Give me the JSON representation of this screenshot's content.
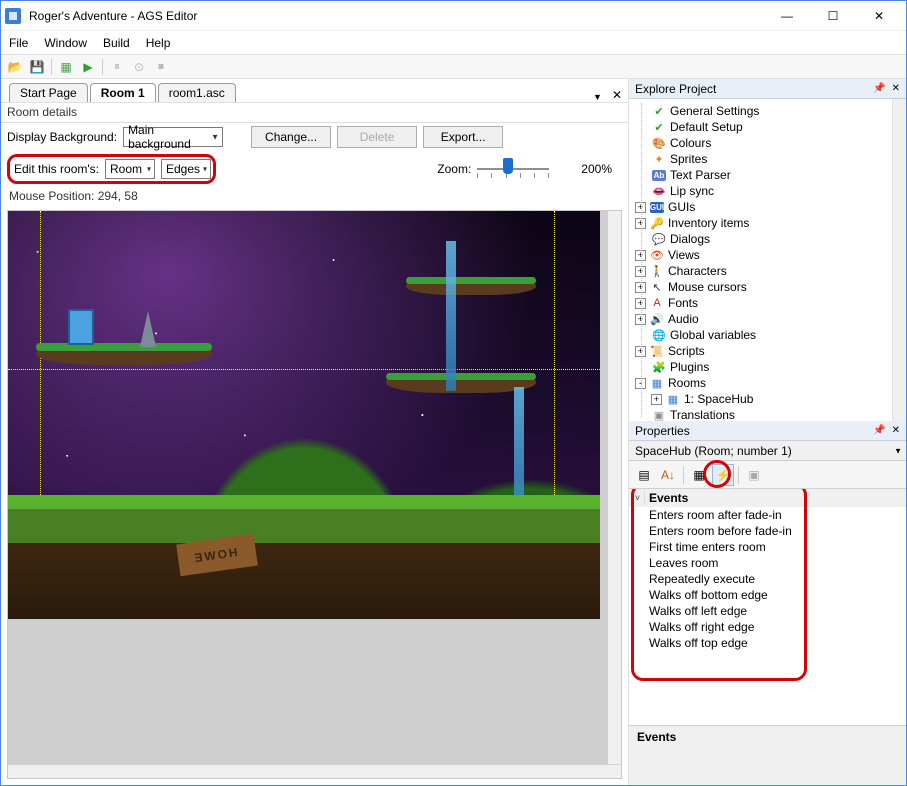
{
  "window": {
    "title": "Roger's Adventure - AGS Editor"
  },
  "menu": {
    "file": "File",
    "window": "Window",
    "build": "Build",
    "help": "Help"
  },
  "tabs": {
    "start": "Start Page",
    "room": "Room 1",
    "script": "room1.asc"
  },
  "roomEditor": {
    "detailsLabel": "Room details",
    "displayBgLabel": "Display Background:",
    "displayBgValue": "Main background",
    "changeBtn": "Change...",
    "deleteBtn": "Delete",
    "exportBtn": "Export...",
    "editLabel": "Edit this room's:",
    "roomCombo": "Room",
    "edgesCombo": "Edges",
    "zoomLabel": "Zoom:",
    "zoomValue": "200%",
    "mousePosLabel": "Mouse Position: 294, 58"
  },
  "explore": {
    "title": "Explore Project",
    "items": [
      {
        "icon": "✔",
        "color": "#2e9f2e",
        "label": "General Settings",
        "exp": ""
      },
      {
        "icon": "✔",
        "color": "#2e9f2e",
        "label": "Default Setup",
        "exp": ""
      },
      {
        "icon": "🎨",
        "color": "#d28c2c",
        "label": "Colours",
        "exp": ""
      },
      {
        "icon": "✦",
        "color": "#d28c2c",
        "label": "Sprites",
        "exp": ""
      },
      {
        "icon": "Ab",
        "color": "#5a7bd8",
        "label": "Text Parser",
        "exp": ""
      },
      {
        "icon": "👄",
        "color": "#c02424",
        "label": "Lip sync",
        "exp": ""
      },
      {
        "icon": "GUI",
        "color": "#2b5fc9",
        "label": "GUIs",
        "exp": "+"
      },
      {
        "icon": "🔑",
        "color": "#d28c2c",
        "label": "Inventory items",
        "exp": "+"
      },
      {
        "icon": "💬",
        "color": "#d28c2c",
        "label": "Dialogs",
        "exp": ""
      },
      {
        "icon": "👁",
        "color": "#c94f10",
        "label": "Views",
        "exp": "+"
      },
      {
        "icon": "🚶",
        "color": "#c45a00",
        "label": "Characters",
        "exp": "+"
      },
      {
        "icon": "↖",
        "color": "#333",
        "label": "Mouse cursors",
        "exp": "+"
      },
      {
        "icon": "A",
        "color": "#c02424",
        "label": "Fonts",
        "exp": "+"
      },
      {
        "icon": "🔊",
        "color": "#3a7dd8",
        "label": "Audio",
        "exp": "+"
      },
      {
        "icon": "🌐",
        "color": "#2b7fb8",
        "label": "Global variables",
        "exp": ""
      },
      {
        "icon": "📜",
        "color": "#d28c2c",
        "label": "Scripts",
        "exp": "+"
      },
      {
        "icon": "🧩",
        "color": "#3a9f3a",
        "label": "Plugins",
        "exp": ""
      },
      {
        "icon": "▦",
        "color": "#3a7dd8",
        "label": "Rooms",
        "exp": "-"
      },
      {
        "icon": "▦",
        "color": "#3a7dd8",
        "label": "1: SpaceHub",
        "exp": "+",
        "indent": 1
      },
      {
        "icon": "▣",
        "color": "#8e8e8e",
        "label": "Translations",
        "exp": ""
      }
    ]
  },
  "properties": {
    "title": "Properties",
    "objectName": "SpaceHub (Room; number 1)",
    "category": "Events",
    "events": [
      "Enters room after fade-in",
      "Enters room before fade-in",
      "First time enters room",
      "Leaves room",
      "Repeatedly execute",
      "Walks off bottom edge",
      "Walks off left edge",
      "Walks off right edge",
      "Walks off top edge"
    ],
    "descTitle": "Events"
  },
  "icons": {
    "open": "📂",
    "save": "💾",
    "build": "▦",
    "run": "▶"
  },
  "colors": {
    "highlight": "#d3030b"
  }
}
